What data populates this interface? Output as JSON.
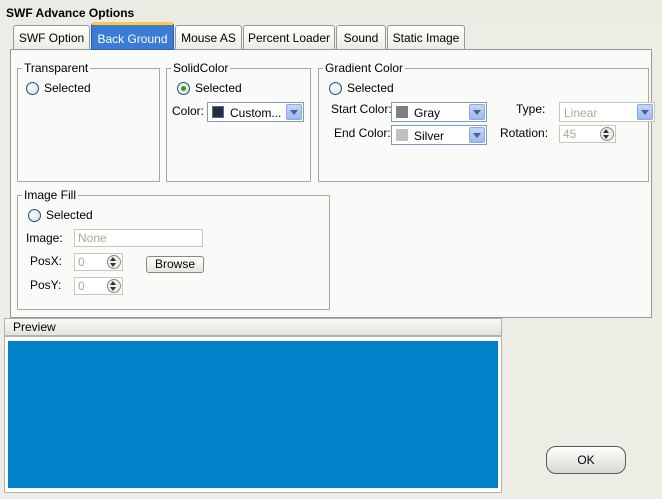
{
  "window": {
    "title": "SWF Advance Options"
  },
  "tabs": [
    {
      "label": "SWF Option"
    },
    {
      "label": "Back Ground",
      "active": true
    },
    {
      "label": "Mouse AS"
    },
    {
      "label": "Percent Loader"
    },
    {
      "label": "Sound"
    },
    {
      "label": "Static Image"
    }
  ],
  "transparent": {
    "legend": "Transparent",
    "radio_label": "Selected",
    "selected": false
  },
  "solid_color": {
    "legend": "SolidColor",
    "radio_label": "Selected",
    "selected": true,
    "color_label": "Color:",
    "color_value": "Custom...",
    "swatch": "#1e2f4e"
  },
  "gradient": {
    "legend": "Gradient Color",
    "radio_label": "Selected",
    "selected": false,
    "start_label": "Start Color:",
    "start_value": "Gray",
    "start_swatch": "#808080",
    "end_label": "End Color:",
    "end_value": "Silver",
    "end_swatch": "#c0c0c0",
    "type_label": "Type:",
    "type_value": "Linear",
    "rotation_label": "Rotation:",
    "rotation_value": "45"
  },
  "image_fill": {
    "legend": "Image Fill",
    "radio_label": "Selected",
    "selected": false,
    "image_label": "Image:",
    "image_value": "None",
    "posx_label": "PosX:",
    "posx_value": "0",
    "posy_label": "PosY:",
    "posy_value": "0",
    "browse_label": "Browse"
  },
  "preview": {
    "header": "Preview",
    "fill_color": "#0082c8"
  },
  "ok_label": "OK"
}
